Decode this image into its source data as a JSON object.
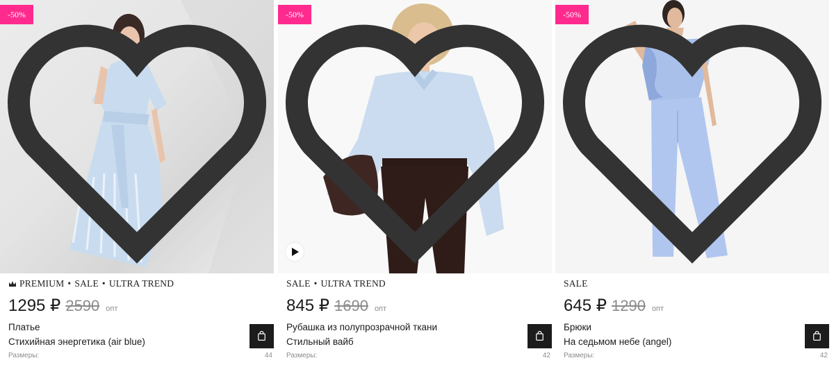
{
  "products": [
    {
      "badge": "-50%",
      "tags": [
        "PREMIUM",
        "SALE",
        "ULTRA TREND"
      ],
      "premium_icon": "crown-icon",
      "price": "1295 ₽",
      "old_price": "2590",
      "price_note": "опт",
      "name": "Платье",
      "collection": "Стихийная энергетика (air blue)",
      "sizes_label": "Размеры:",
      "sizes_count": "44",
      "has_video": false
    },
    {
      "badge": "-50%",
      "tags": [
        "SALE",
        "ULTRA TREND"
      ],
      "price": "845 ₽",
      "old_price": "1690",
      "price_note": "опт",
      "name": "Рубашка из полупрозрачной ткани",
      "collection": "Стильный вайб",
      "sizes_label": "Размеры:",
      "sizes_count": "42",
      "has_video": true
    },
    {
      "badge": "-50%",
      "tags": [
        "SALE"
      ],
      "price": "645 ₽",
      "old_price": "1290",
      "price_note": "опт",
      "name": "Брюки",
      "collection": "На седьмом небе (angel)",
      "sizes_label": "Размеры:",
      "sizes_count": "42",
      "has_video": false
    }
  ],
  "icons": {
    "favorite": "heart-outline-icon",
    "cart": "shopping-bag-icon",
    "video": "play-icon"
  },
  "colors": {
    "badge": "#ff2a8e",
    "cart_button": "#1c1c1c",
    "old_price": "#8c8c8c"
  }
}
